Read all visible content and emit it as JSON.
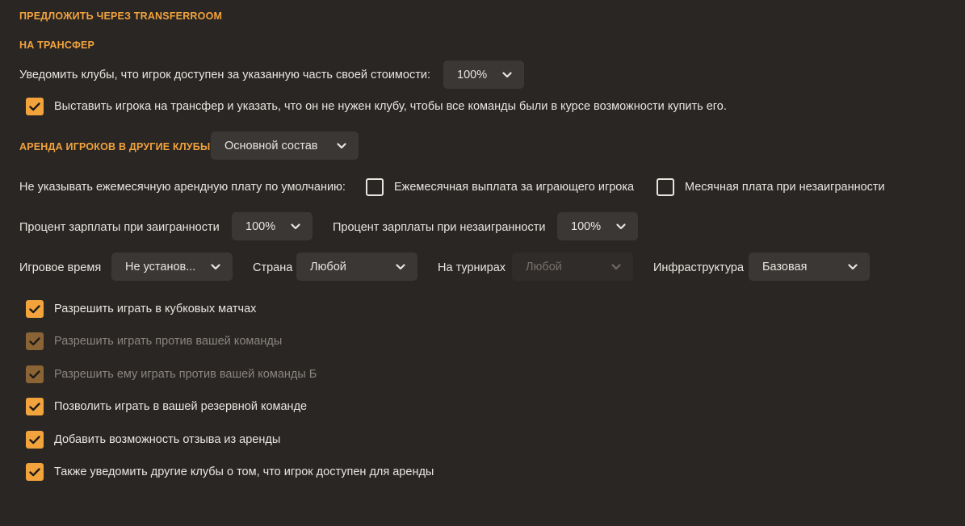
{
  "transferroom_heading": "ПРЕДЛОЖИТЬ ЧЕРЕЗ TRANSFERROOM",
  "transfer": {
    "heading": "НА ТРАНСФЕР",
    "notify_label": "Уведомить клубы, что игрок доступен за указанную часть своей стоимости:",
    "notify_value": "100%",
    "list_checked": true,
    "list_label": "Выставить игрока на трансфер и указать, что он не нужен клубу, чтобы все команды были в курсе возможности купить его."
  },
  "loan": {
    "heading": "АРЕНДА ИГРОКОВ В ДРУГИЕ КЛУБЫ",
    "squad_value": "Основной состав",
    "monthly_fee_label": "Не указывать ежемесячную арендную плату по умолчанию:",
    "fee_playing_label": "Ежемесячная выплата за играющего игрока",
    "fee_playing_checked": false,
    "fee_not_playing_label": "Месячная плата при незаигранности",
    "fee_not_playing_checked": false,
    "wage_playing_label": "Процент зарплаты при заигранности",
    "wage_playing_value": "100%",
    "wage_not_playing_label": "Процент зарплаты при незаигранности",
    "wage_not_playing_value": "100%",
    "playing_time_label": "Игровое время",
    "playing_time_value": "Не установ...",
    "country_label": "Страна",
    "country_value": "Любой",
    "tournaments_label": "На турнирах",
    "tournaments_value": "Любой",
    "infrastructure_label": "Инфраструктура",
    "infrastructure_value": "Базовая",
    "options": [
      {
        "label": "Разрешить играть в кубковых матчах",
        "checked": true,
        "enabled": true
      },
      {
        "label": "Разрешить играть против вашей команды",
        "checked": true,
        "enabled": false
      },
      {
        "label": "Разрешить ему играть против вашей команды Б",
        "checked": true,
        "enabled": false
      },
      {
        "label": "Позволить играть в вашей резервной команде",
        "checked": true,
        "enabled": true
      },
      {
        "label": "Добавить возможность отзыва из аренды",
        "checked": true,
        "enabled": true
      },
      {
        "label": "Также уведомить другие клубы о том, что игрок доступен для аренды",
        "checked": true,
        "enabled": true
      }
    ]
  },
  "colors": {
    "background": "#2a2624",
    "accent": "#f2a33c",
    "accent_disabled": "#8a6434",
    "control_bg": "#3b3735",
    "text": "#e8e5e1",
    "text_disabled": "#8a8580"
  }
}
